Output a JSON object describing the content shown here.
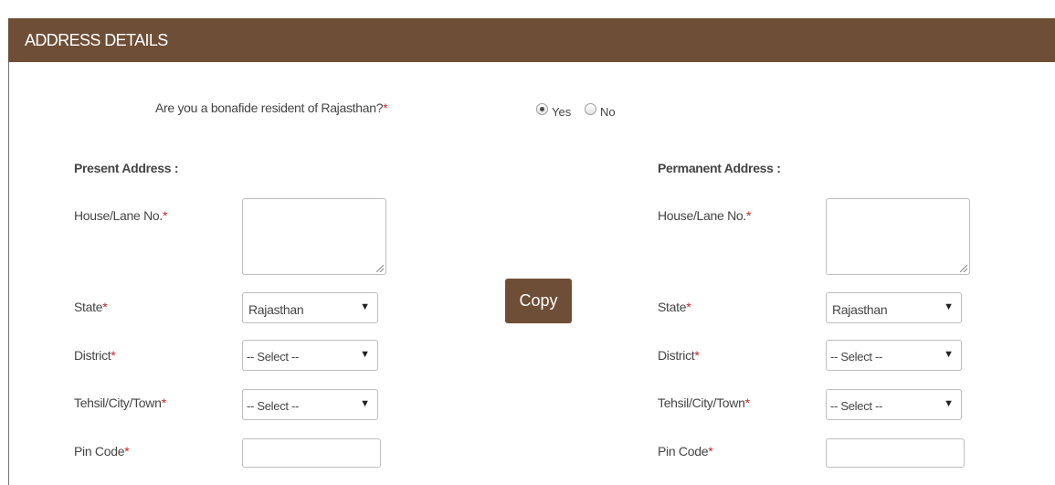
{
  "header": {
    "title": "ADDRESS DETAILS"
  },
  "resident": {
    "question": "Are you a bonafide resident of Rajasthan?",
    "required_mark": "*",
    "options": [
      {
        "label": "Yes",
        "checked": true
      },
      {
        "label": "No",
        "checked": false
      }
    ]
  },
  "present": {
    "title": "Present Address :",
    "house_label": "House/Lane No.",
    "house_value": "",
    "state_label": "State",
    "state_value": "Rajasthan",
    "district_label": "District",
    "district_value": "-- Select --",
    "tehsil_label": "Tehsil/City/Town",
    "tehsil_value": "-- Select --",
    "pin_label": "Pin Code",
    "pin_value": ""
  },
  "permanent": {
    "title": "Permanent Address :",
    "house_label": "House/Lane No.",
    "house_value": "",
    "state_label": "State",
    "state_value": "Rajasthan",
    "district_label": "District",
    "district_value": "-- Select --",
    "tehsil_label": "Tehsil/City/Town",
    "tehsil_value": "-- Select --",
    "pin_label": "Pin Code",
    "pin_value": ""
  },
  "copy_button": {
    "label": "Copy"
  },
  "required_mark": "*",
  "colors": {
    "header_bg": "#6e4e36",
    "required": "#d21f1f",
    "text": "#444444"
  },
  "icons": {
    "dropdown": "triangle-down-icon",
    "resize": "resize-grip-icon"
  }
}
